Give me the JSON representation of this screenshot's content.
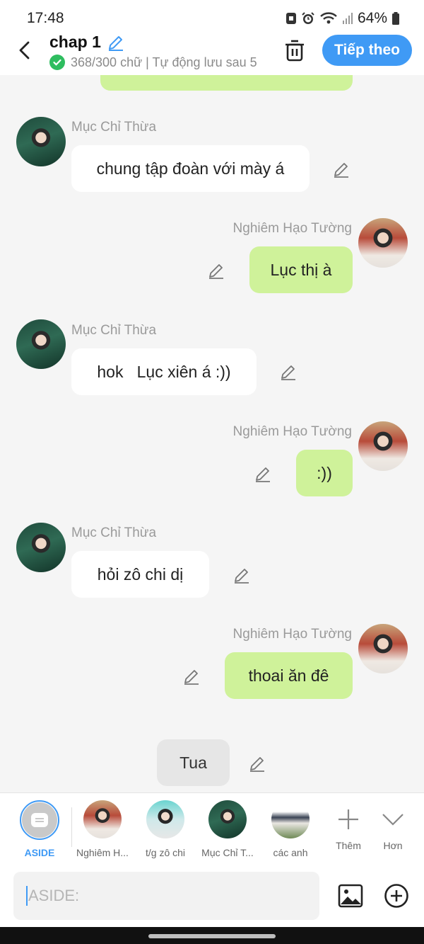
{
  "status": {
    "time": "17:48",
    "battery": "64%"
  },
  "header": {
    "title": "chap 1",
    "subtitle": "368/300 chữ | Tự động lưu sau 5",
    "next_label": "Tiếp theo"
  },
  "messages": [
    {
      "side": "left",
      "name": "Mục Chỉ Thừa",
      "text": "chung tập đoàn với mày á"
    },
    {
      "side": "right",
      "name": "Nghiêm Hạo Tường",
      "text": "Lục thị à"
    },
    {
      "side": "left",
      "name": "Mục Chỉ Thừa",
      "text": "hok   Lục xiên á :))"
    },
    {
      "side": "right",
      "name": "Nghiêm Hạo Tường",
      "text": ":))"
    },
    {
      "side": "left",
      "name": "Mục Chỉ Thừa",
      "text": "hỏi zô chi dị"
    },
    {
      "side": "right",
      "name": "Nghiêm Hạo Tường",
      "text": "thoai ăn đê"
    },
    {
      "side": "center",
      "text": "Tua"
    }
  ],
  "characters": [
    {
      "label": "ASIDE",
      "icon": "aside-icon",
      "selected": true
    },
    {
      "label": "Nghiêm H..."
    },
    {
      "label": "t/g zô chi"
    },
    {
      "label": "Mục Chỉ T..."
    },
    {
      "label": "các anh"
    },
    {
      "label": "Thêm",
      "icon": "plus-icon"
    },
    {
      "label": "Hơn",
      "icon": "chevron-down-icon"
    }
  ],
  "input": {
    "placeholder": "ASIDE:"
  },
  "colors": {
    "accent": "#3f9af5",
    "right_bubble": "#cff29a",
    "left_bubble": "#ffffff"
  }
}
